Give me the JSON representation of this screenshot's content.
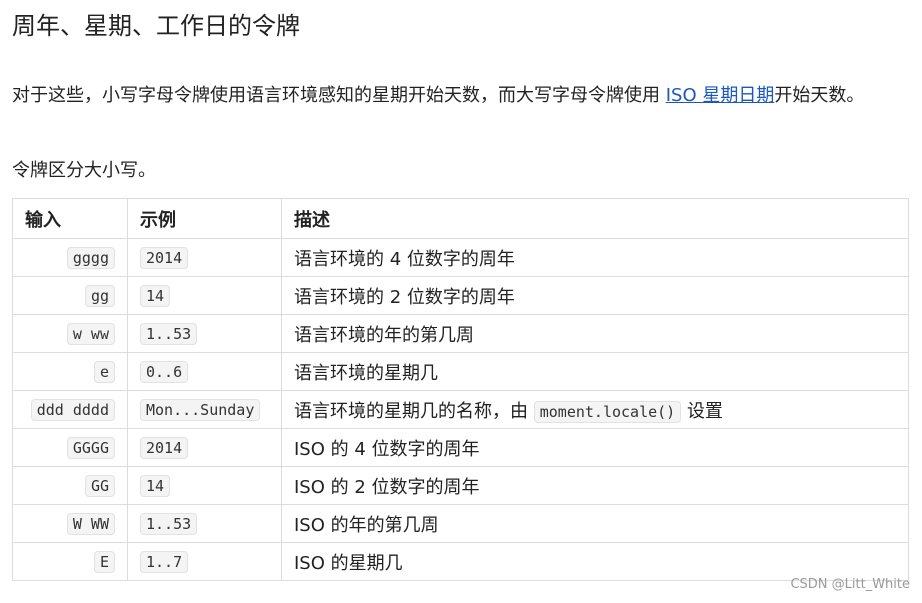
{
  "title": "周年、星期、工作日的令牌",
  "paragraph1": {
    "before": "对于这些，小写字母令牌使用语言环境感知的星期开始天数，而大写字母令牌使用 ",
    "link": "ISO 星期日期",
    "after": "开始天数。"
  },
  "paragraph2": "令牌区分大小写。",
  "table": {
    "headers": [
      "输入",
      "示例",
      "描述"
    ],
    "rows": [
      {
        "input": "gggg",
        "example": "2014",
        "desc": "语言环境的 4 位数字的周年"
      },
      {
        "input": "gg",
        "example": "14",
        "desc": "语言环境的 2 位数字的周年"
      },
      {
        "input": "w ww",
        "example": "1..53",
        "desc": "语言环境的年的第几周"
      },
      {
        "input": "e",
        "example": "0..6",
        "desc": "语言环境的星期几"
      },
      {
        "input": "ddd dddd",
        "example": "Mon...Sunday",
        "desc": "语言环境的星期几的名称，由",
        "code": "moment.locale()",
        "desc_after": "设置"
      },
      {
        "input": "GGGG",
        "example": "2014",
        "desc": "ISO 的 4 位数字的周年"
      },
      {
        "input": "GG",
        "example": "14",
        "desc": "ISO 的 2 位数字的周年"
      },
      {
        "input": "W WW",
        "example": "1..53",
        "desc": "ISO 的年的第几周"
      },
      {
        "input": "E",
        "example": "1..7",
        "desc": "ISO 的星期几"
      }
    ]
  },
  "watermark": "CSDN @Litt_White"
}
